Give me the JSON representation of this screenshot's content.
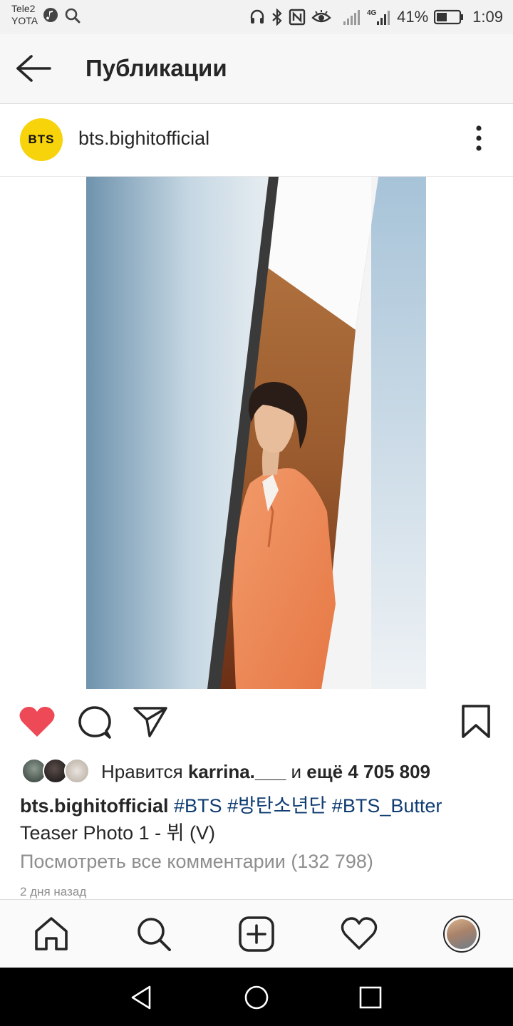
{
  "status_bar": {
    "carrier_1": "Tele2",
    "carrier_2": "YOTA",
    "battery": "41%",
    "time": "1:09"
  },
  "header": {
    "title": "Публикации"
  },
  "post": {
    "username": "bts.bighitofficial",
    "avatar_text": "BTS",
    "avatar_color": "#f6d30b",
    "likes": {
      "prefix": "Нравится ",
      "user": "karrina.___",
      "middle": " и ",
      "count": "ещё 4 705 809"
    },
    "caption": {
      "user": "bts.bighitofficial",
      "tags": [
        "#BTS",
        "#방탄소년단",
        "#BTS_Butter"
      ],
      "text": "Teaser Photo 1 - 뷔 (V)"
    },
    "comments_link": "Посмотреть все комментарии (132 798)",
    "time_ago": "2 дня назад",
    "liked": true,
    "like_color": "#ed4956",
    "hashtag_color": "#0f3c72"
  },
  "icons": {
    "back": "arrow-left-icon",
    "more": "more-vertical-icon",
    "like": "heart-filled-icon",
    "comment": "comment-icon",
    "share": "send-icon",
    "save": "bookmark-icon",
    "home": "home-icon",
    "search": "search-icon",
    "add": "add-post-icon",
    "activity": "heart-outline-icon",
    "profile": "profile-avatar"
  }
}
